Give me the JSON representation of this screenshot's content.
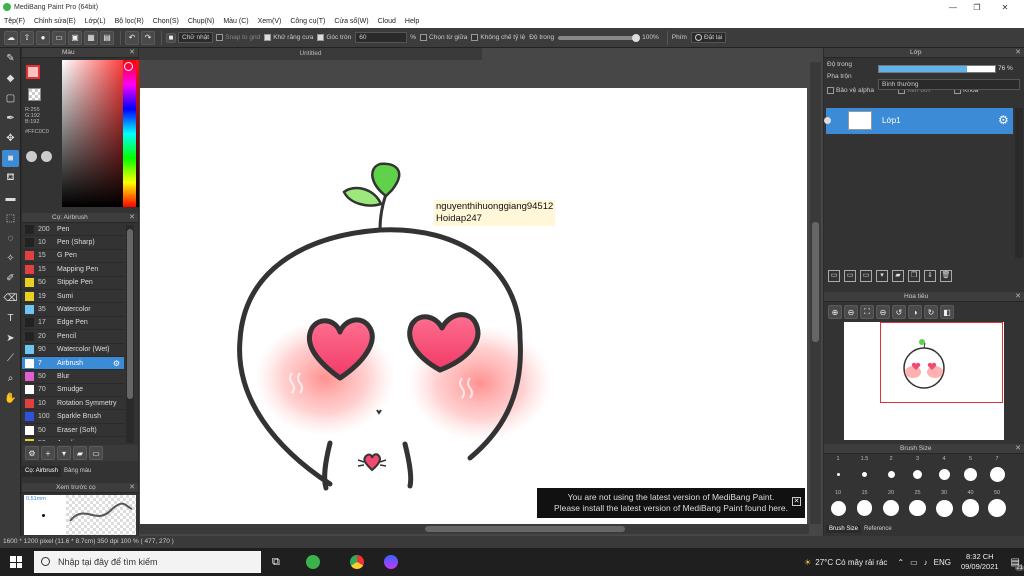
{
  "window": {
    "title": "MediBang Paint Pro (64bit)",
    "minimize": "—",
    "maximize": "❐",
    "close": "✕"
  },
  "menu": [
    "Tệp(F)",
    "Chỉnh sửa(E)",
    "Lớp(L)",
    "Bộ lọc(R)",
    "Chọn(S)",
    "Chụp(N)",
    "Màu (C)",
    "Xem(V)",
    "Công cụ(T)",
    "Cửa sổ(W)",
    "Cloud",
    "Help"
  ],
  "toolbar": {
    "shape_select": "Chữ nhật",
    "snap_to_grid": "Snap to grid",
    "antialias": "Khử răng cưa",
    "corner_round": "Góc tròn",
    "corner_value": "60",
    "percent_sign": "%",
    "center_select": "Chọn từ giữa",
    "no_ratio": "Không chế tỷ lệ",
    "opacity_label": "Độ trong",
    "opacity_value": "100%",
    "shortcut_label": "Phím",
    "reset_label": "Đặt lại"
  },
  "color_panel": {
    "title": "Màu",
    "r": "R:255",
    "g": "G:192",
    "b": "B:192",
    "hex": "#FFC0C0",
    "main_color": "#ffc0c0"
  },
  "brush_panel": {
    "title": "Cọ: Airbrush",
    "brushes": [
      {
        "size": "200",
        "name": "Pen",
        "color": "#222222"
      },
      {
        "size": "10",
        "name": "Pen (Sharp)",
        "color": "#222222"
      },
      {
        "size": "15",
        "name": "G Pen",
        "color": "#e04040"
      },
      {
        "size": "15",
        "name": "Mapping Pen",
        "color": "#e04040"
      },
      {
        "size": "50",
        "name": "Stipple Pen",
        "color": "#e8d020"
      },
      {
        "size": "19",
        "name": "Sumi",
        "color": "#e8d020"
      },
      {
        "size": "35",
        "name": "Watercolor",
        "color": "#6ec6f0"
      },
      {
        "size": "17",
        "name": "Edge Pen",
        "color": "#222222"
      },
      {
        "size": "20",
        "name": "Pencil",
        "color": "#222222"
      },
      {
        "size": "90",
        "name": "Watercolor (Wet)",
        "color": "#6ec6f0"
      },
      {
        "size": "7",
        "name": "Airbrush",
        "color": "#ffffff"
      },
      {
        "size": "50",
        "name": "Blur",
        "color": "#e060d0"
      },
      {
        "size": "70",
        "name": "Smudge",
        "color": "#ffffff"
      },
      {
        "size": "10",
        "name": "Rotation Symmetry",
        "color": "#e04040"
      },
      {
        "size": "100",
        "name": "Sparkle Brush",
        "color": "#3050e0"
      },
      {
        "size": "50",
        "name": "Eraser (Soft)",
        "color": "#ffffff"
      },
      {
        "size": "50",
        "name": "Acrylic",
        "color": "#e8d020"
      }
    ],
    "tab_brush": "Cọ: Airbrush",
    "tab_palette": "Bảng màu"
  },
  "preview_panel": {
    "title": "Xem trước cọ",
    "size": "0.51mm"
  },
  "document": {
    "tab": "Untitled"
  },
  "canvas": {
    "signature_line1": "nguyenthihuonggiang94512",
    "signature_line2": "Hoidap247"
  },
  "notice": {
    "line1": "You are not using the latest version of MediBang Paint.",
    "line2": "Please install the latest version of MediBang Paint found here."
  },
  "layer_panel": {
    "title": "Lớp",
    "opacity_label": "Độ trong",
    "opacity_value": "76 %",
    "opacity_fraction": 0.76,
    "blend_label": "Pha trộn",
    "blend_value": "Bình thường",
    "protect_alpha": "Bảo vệ alpha",
    "clipping": "Xén bớt",
    "lock": "Khóa",
    "layer_name": "Lớp1"
  },
  "navigator": {
    "title": "Hoa tiêu"
  },
  "brush_size_panel": {
    "title": "Brush Size",
    "row1": [
      "1",
      "1.5",
      "2",
      "3",
      "4",
      "5",
      "7"
    ],
    "row2": [
      "10",
      "15",
      "20",
      "25",
      "30",
      "40",
      "50"
    ],
    "tab1": "Brush Size",
    "tab2": "Reference"
  },
  "status": {
    "text": "1600 * 1200 pixel   (11.6 * 8.7cm)   350 dpi   100 %   ( 477, 270 )"
  },
  "taskbar": {
    "search": "Nhập tại đây để tìm kiếm",
    "weather": "27°C  Có mây rải rác",
    "lang": "ENG",
    "time": "8:32 CH",
    "date": "09/09/2021",
    "notifications": "21"
  }
}
